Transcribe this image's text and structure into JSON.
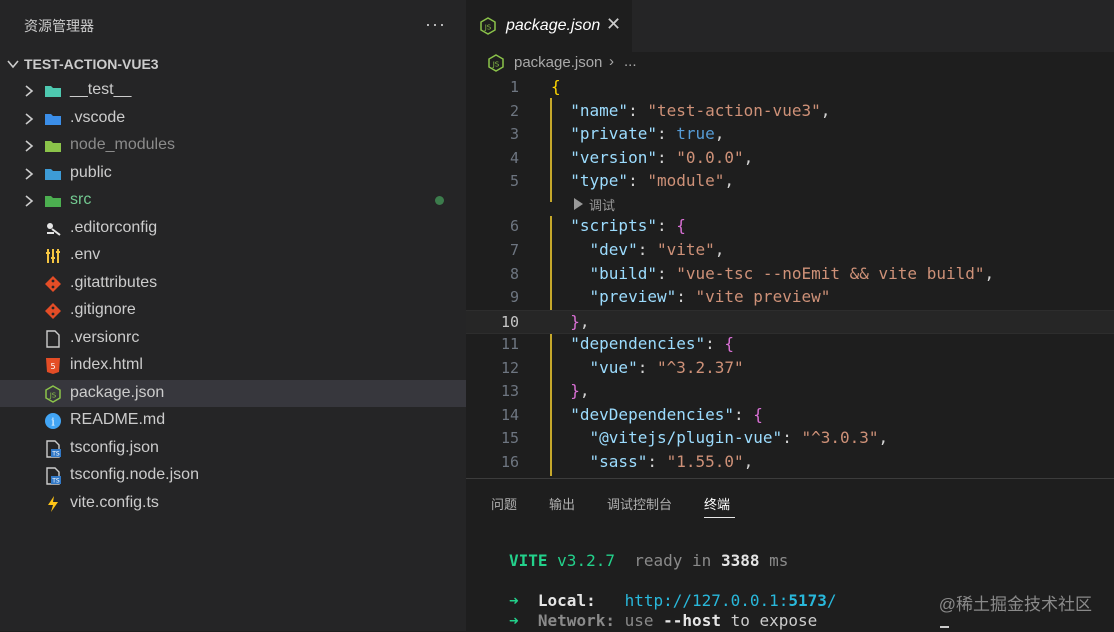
{
  "sidebar": {
    "title": "资源管理器",
    "more": "···",
    "folder": "TEST-ACTION-VUE3",
    "items": [
      {
        "label": "__test__",
        "type": "folder",
        "icon": "folder-test-icon",
        "color": "#4ec9b0",
        "state": "normal"
      },
      {
        "label": ".vscode",
        "type": "folder",
        "icon": "folder-vscode-icon",
        "color": "#3b8ee8",
        "state": "normal"
      },
      {
        "label": "node_modules",
        "type": "folder",
        "icon": "folder-node-icon",
        "color": "#8bc34a",
        "state": "dim"
      },
      {
        "label": "public",
        "type": "folder",
        "icon": "folder-public-icon",
        "color": "#3d9bd6",
        "state": "normal"
      },
      {
        "label": "src",
        "type": "folder",
        "icon": "folder-src-icon",
        "color": "#4caf50",
        "state": "modified"
      },
      {
        "label": ".editorconfig",
        "type": "file",
        "icon": "editorconfig-icon",
        "color": "#e5e5e5",
        "state": "normal"
      },
      {
        "label": ".env",
        "type": "file",
        "icon": "env-icon",
        "color": "#f4c542",
        "state": "normal"
      },
      {
        "label": ".gitattributes",
        "type": "file",
        "icon": "git-icon",
        "color": "#e44d26",
        "state": "normal"
      },
      {
        "label": ".gitignore",
        "type": "file",
        "icon": "git-icon",
        "color": "#e44d26",
        "state": "normal"
      },
      {
        "label": ".versionrc",
        "type": "file",
        "icon": "file-icon",
        "color": "#cccccc",
        "state": "normal"
      },
      {
        "label": "index.html",
        "type": "file",
        "icon": "html-icon",
        "color": "#e44d26",
        "state": "normal"
      },
      {
        "label": "package.json",
        "type": "file",
        "icon": "nodejs-icon",
        "color": "#8bc34a",
        "state": "selected"
      },
      {
        "label": "README.md",
        "type": "file",
        "icon": "info-icon",
        "color": "#42a5f5",
        "state": "normal"
      },
      {
        "label": "tsconfig.json",
        "type": "file",
        "icon": "tsconfig-icon",
        "color": "#3178c6",
        "state": "normal"
      },
      {
        "label": "tsconfig.node.json",
        "type": "file",
        "icon": "tsconfig-icon",
        "color": "#3178c6",
        "state": "normal"
      },
      {
        "label": "vite.config.ts",
        "type": "file",
        "icon": "vite-icon",
        "color": "#ffc517",
        "state": "normal"
      }
    ]
  },
  "editor": {
    "tab": {
      "label": "package.json",
      "close": "✕"
    },
    "breadcrumb": {
      "file": "package.json",
      "separator": "›",
      "more": "..."
    },
    "codelens": "调试",
    "current_line": 10,
    "lines": [
      {
        "n": "1",
        "tokens": [
          {
            "t": "{",
            "c": "b1"
          }
        ]
      },
      {
        "n": "2",
        "tokens": [
          {
            "t": "  ",
            "c": "p"
          },
          {
            "t": "\"name\"",
            "c": "k"
          },
          {
            "t": ": ",
            "c": "p"
          },
          {
            "t": "\"test-action-vue3\"",
            "c": "s"
          },
          {
            "t": ",",
            "c": "p"
          }
        ]
      },
      {
        "n": "3",
        "tokens": [
          {
            "t": "  ",
            "c": "p"
          },
          {
            "t": "\"private\"",
            "c": "k"
          },
          {
            "t": ": ",
            "c": "p"
          },
          {
            "t": "true",
            "c": "kw"
          },
          {
            "t": ",",
            "c": "p"
          }
        ]
      },
      {
        "n": "4",
        "tokens": [
          {
            "t": "  ",
            "c": "p"
          },
          {
            "t": "\"version\"",
            "c": "k"
          },
          {
            "t": ": ",
            "c": "p"
          },
          {
            "t": "\"0.0.0\"",
            "c": "s"
          },
          {
            "t": ",",
            "c": "p"
          }
        ]
      },
      {
        "n": "5",
        "tokens": [
          {
            "t": "  ",
            "c": "p"
          },
          {
            "t": "\"type\"",
            "c": "k"
          },
          {
            "t": ": ",
            "c": "p"
          },
          {
            "t": "\"module\"",
            "c": "s"
          },
          {
            "t": ",",
            "c": "p"
          }
        ]
      },
      {
        "n": "6",
        "tokens": [
          {
            "t": "  ",
            "c": "p"
          },
          {
            "t": "\"scripts\"",
            "c": "k"
          },
          {
            "t": ": ",
            "c": "p"
          },
          {
            "t": "{",
            "c": "b2"
          }
        ]
      },
      {
        "n": "7",
        "tokens": [
          {
            "t": "    ",
            "c": "p"
          },
          {
            "t": "\"dev\"",
            "c": "k"
          },
          {
            "t": ": ",
            "c": "p"
          },
          {
            "t": "\"vite\"",
            "c": "s"
          },
          {
            "t": ",",
            "c": "p"
          }
        ]
      },
      {
        "n": "8",
        "tokens": [
          {
            "t": "    ",
            "c": "p"
          },
          {
            "t": "\"build\"",
            "c": "k"
          },
          {
            "t": ": ",
            "c": "p"
          },
          {
            "t": "\"vue-tsc --noEmit && vite build\"",
            "c": "s"
          },
          {
            "t": ",",
            "c": "p"
          }
        ]
      },
      {
        "n": "9",
        "tokens": [
          {
            "t": "    ",
            "c": "p"
          },
          {
            "t": "\"preview\"",
            "c": "k"
          },
          {
            "t": ": ",
            "c": "p"
          },
          {
            "t": "\"vite preview\"",
            "c": "s"
          }
        ]
      },
      {
        "n": "10",
        "tokens": [
          {
            "t": "  ",
            "c": "p"
          },
          {
            "t": "}",
            "c": "b2"
          },
          {
            "t": ",",
            "c": "p"
          }
        ]
      },
      {
        "n": "11",
        "tokens": [
          {
            "t": "  ",
            "c": "p"
          },
          {
            "t": "\"dependencies\"",
            "c": "k"
          },
          {
            "t": ": ",
            "c": "p"
          },
          {
            "t": "{",
            "c": "b2"
          }
        ]
      },
      {
        "n": "12",
        "tokens": [
          {
            "t": "    ",
            "c": "p"
          },
          {
            "t": "\"vue\"",
            "c": "k"
          },
          {
            "t": ": ",
            "c": "p"
          },
          {
            "t": "\"^3.2.37\"",
            "c": "s"
          }
        ]
      },
      {
        "n": "13",
        "tokens": [
          {
            "t": "  ",
            "c": "p"
          },
          {
            "t": "}",
            "c": "b2"
          },
          {
            "t": ",",
            "c": "p"
          }
        ]
      },
      {
        "n": "14",
        "tokens": [
          {
            "t": "  ",
            "c": "p"
          },
          {
            "t": "\"devDependencies\"",
            "c": "k"
          },
          {
            "t": ": ",
            "c": "p"
          },
          {
            "t": "{",
            "c": "b2"
          }
        ]
      },
      {
        "n": "15",
        "tokens": [
          {
            "t": "    ",
            "c": "p"
          },
          {
            "t": "\"@vitejs/plugin-vue\"",
            "c": "k"
          },
          {
            "t": ": ",
            "c": "p"
          },
          {
            "t": "\"^3.0.3\"",
            "c": "s"
          },
          {
            "t": ",",
            "c": "p"
          }
        ]
      },
      {
        "n": "16",
        "tokens": [
          {
            "t": "    ",
            "c": "p"
          },
          {
            "t": "\"sass\"",
            "c": "k"
          },
          {
            "t": ": ",
            "c": "p"
          },
          {
            "t": "\"1.55.0\"",
            "c": "s"
          },
          {
            "t": ",",
            "c": "p"
          }
        ]
      }
    ]
  },
  "panel": {
    "tabs": [
      "问题",
      "输出",
      "调试控制台",
      "终端"
    ],
    "active_tab": "终端",
    "terminal": {
      "line1": {
        "name": "VITE",
        "version": "v3.2.7",
        "ready": "ready in",
        "ms_value": "3388",
        "ms_unit": "ms"
      },
      "local": {
        "arrow": "➜",
        "label": "Local:",
        "url_prefix": "http://127.0.0.1:",
        "port": "5173",
        "url_suffix": "/"
      },
      "network": {
        "arrow": "➜",
        "label": "Network:",
        "text_use": "use",
        "flag": "--host",
        "text_rest": "to expose"
      }
    },
    "watermark": "@稀土掘金技术社区"
  }
}
